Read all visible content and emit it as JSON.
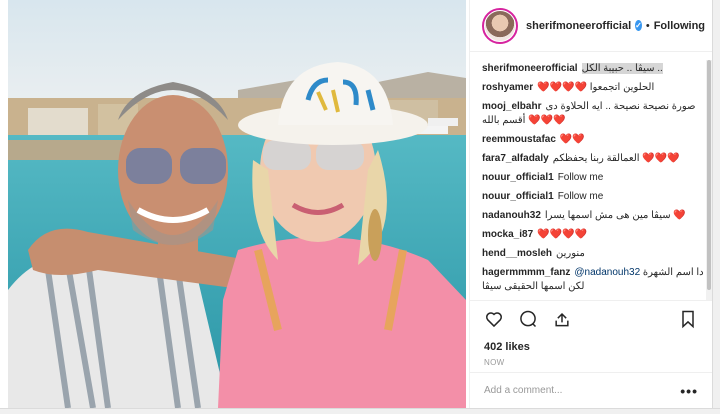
{
  "header": {
    "username": "sherifmoneerofficial",
    "verified_mark": "✓",
    "separator": "•",
    "follow_status": "Following"
  },
  "comments": [
    {
      "user": "sherifmoneerofficial",
      "text": ".. سيڤا .. حبيبة الكل",
      "highlight": true
    },
    {
      "user": "roshyamer",
      "text": "الحلوين اتجمعوا ❤️❤️❤️❤️"
    },
    {
      "user": "mooj_elbahr",
      "text": "صورة نصيحة نصيحة .. ايه الحلاوة دى ❤️❤️❤️ أقسم بالله"
    },
    {
      "user": "reemmoustafac",
      "text": "❤️❤️"
    },
    {
      "user": "fara7_alfadaly",
      "text": "❤️❤️❤️ العمالقة ربنا يحفظكم"
    },
    {
      "user": "nouur_official1",
      "text": "Follow me"
    },
    {
      "user": "nouur_official1",
      "text": "Follow me"
    },
    {
      "user": "nadanouh32",
      "text": "❤️ سيڤا مين هى مش اسمها يسرا"
    },
    {
      "user": "mocka_i87",
      "text": "❤️❤️❤️❤️"
    },
    {
      "user": "hend__mosleh",
      "text": "منورين"
    },
    {
      "user": "hagermmmm_fanz",
      "mention": "@nadanouh32",
      "text": "دا اسم الشهرة لكن اسمها الحقيقى سيڤا"
    }
  ],
  "actions": {
    "like_icon": "heart-icon",
    "comment_icon": "comment-bubble-icon",
    "share_icon": "share-arrow-icon",
    "save_icon": "bookmark-icon"
  },
  "likes_label": "402 likes",
  "time_label": "NOW",
  "add_comment_placeholder": "Add a comment...",
  "more_label": "•••",
  "colors": {
    "accent_blue": "#3897f0",
    "text": "#262626",
    "muted": "#999999",
    "border": "#efefef"
  }
}
